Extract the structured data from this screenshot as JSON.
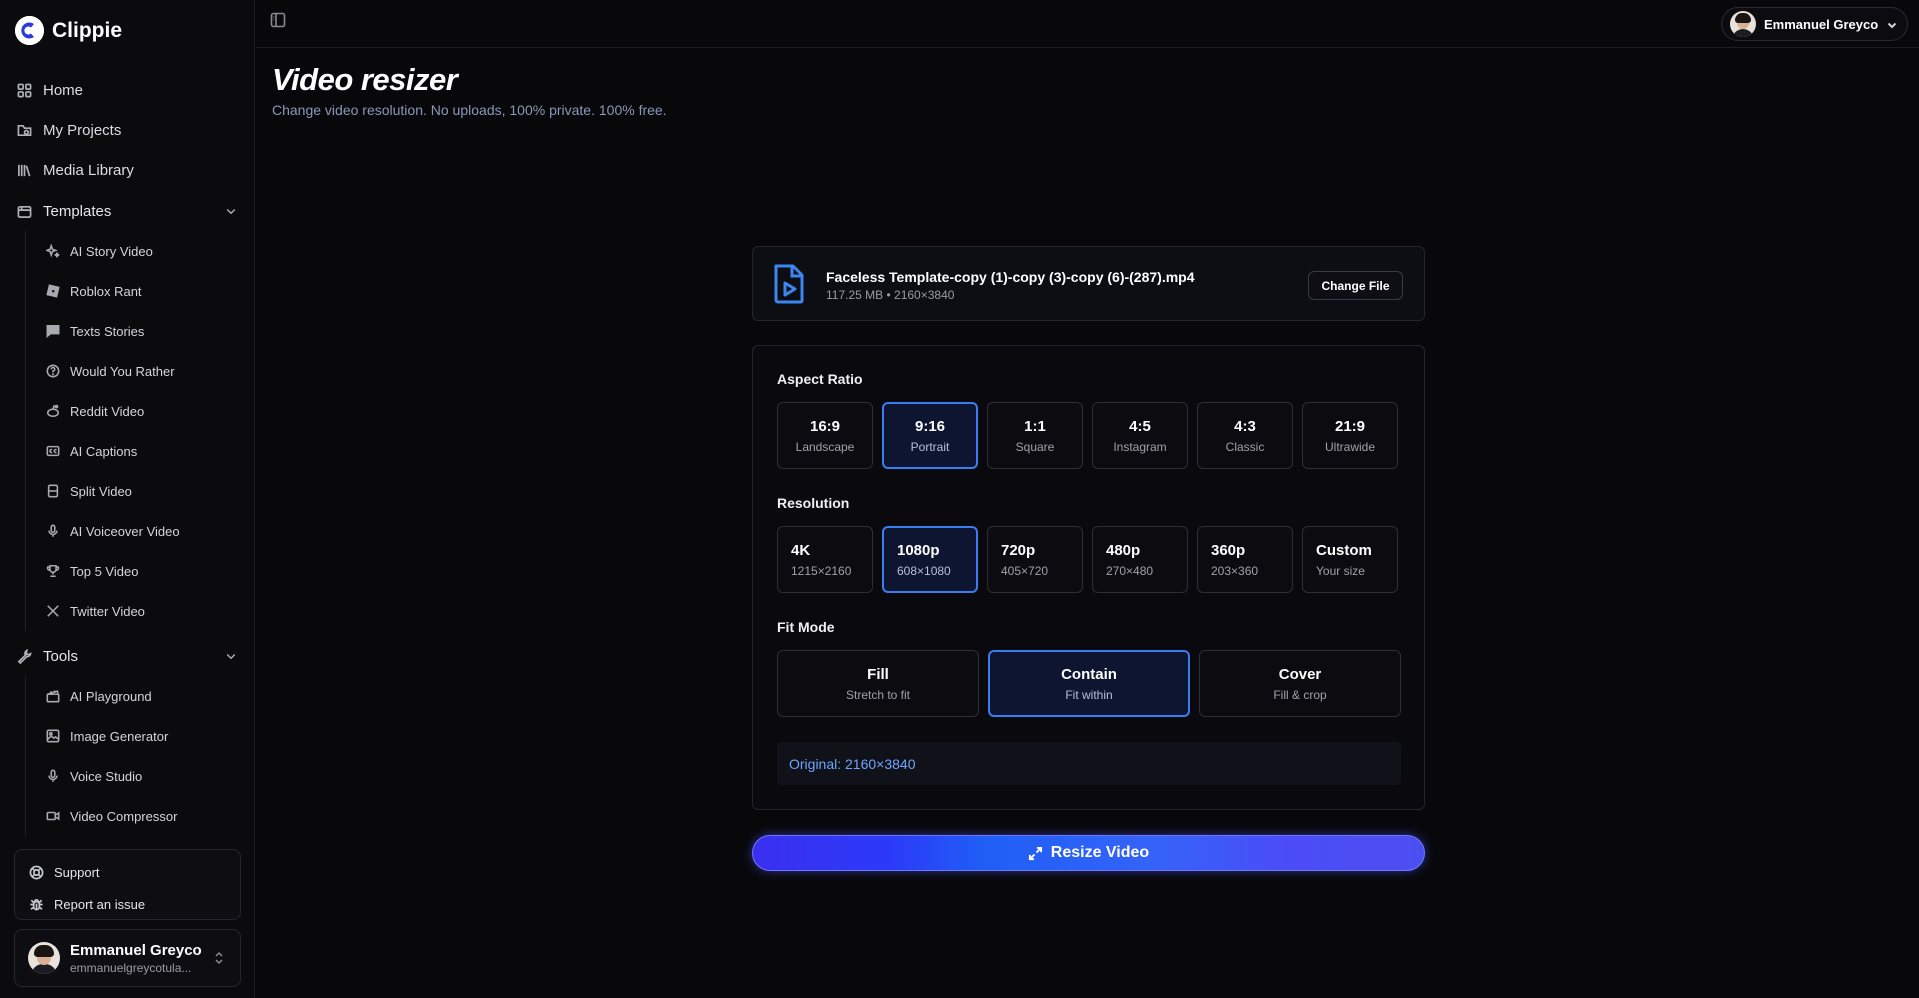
{
  "app": {
    "name": "Clippie"
  },
  "sidebar": {
    "nav": [
      {
        "label": "Home",
        "icon": "grid-icon"
      },
      {
        "label": "My Projects",
        "icon": "folder-icon"
      },
      {
        "label": "Media Library",
        "icon": "library-icon"
      }
    ],
    "templates": {
      "label": "Templates",
      "items": [
        {
          "label": "AI Story Video",
          "icon": "sparkle-icon"
        },
        {
          "label": "Roblox Rant",
          "icon": "roblox-icon"
        },
        {
          "label": "Texts Stories",
          "icon": "message-icon"
        },
        {
          "label": "Would You Rather",
          "icon": "question-icon"
        },
        {
          "label": "Reddit Video",
          "icon": "reddit-icon"
        },
        {
          "label": "AI Captions",
          "icon": "captions-icon"
        },
        {
          "label": "Split Video",
          "icon": "split-icon"
        },
        {
          "label": "AI Voiceover Video",
          "icon": "mic-icon"
        },
        {
          "label": "Top 5 Video",
          "icon": "trophy-icon"
        },
        {
          "label": "Twitter Video",
          "icon": "x-logo-icon"
        }
      ]
    },
    "tools": {
      "label": "Tools",
      "items": [
        {
          "label": "AI Playground",
          "icon": "clapper-icon"
        },
        {
          "label": "Image Generator",
          "icon": "image-icon"
        },
        {
          "label": "Voice Studio",
          "icon": "mic-icon"
        },
        {
          "label": "Video Compressor",
          "icon": "video-icon"
        }
      ]
    },
    "help": [
      {
        "label": "Support",
        "icon": "lifebuoy-icon"
      },
      {
        "label": "Report an issue",
        "icon": "bug-icon"
      }
    ],
    "user": {
      "name": "Emmanuel Greyco",
      "email": "emmanuelgreycotula..."
    }
  },
  "topbar": {
    "user_name": "Emmanuel Greyco"
  },
  "main": {
    "title": "Video resizer",
    "subtitle": "Change video resolution. No uploads, 100% private. 100% free.",
    "file": {
      "name": "Faceless Template-copy (1)-copy (3)-copy (6)-(287).mp4",
      "meta": "117.25 MB • 2160×3840",
      "change_label": "Change File"
    },
    "aspect": {
      "label": "Aspect Ratio",
      "options": [
        {
          "value": "16:9",
          "desc": "Landscape"
        },
        {
          "value": "9:16",
          "desc": "Portrait"
        },
        {
          "value": "1:1",
          "desc": "Square"
        },
        {
          "value": "4:5",
          "desc": "Instagram"
        },
        {
          "value": "4:3",
          "desc": "Classic"
        },
        {
          "value": "21:9",
          "desc": "Ultrawide"
        }
      ],
      "selected": 1
    },
    "resolution": {
      "label": "Resolution",
      "options": [
        {
          "value": "4K",
          "desc": "1215×2160"
        },
        {
          "value": "1080p",
          "desc": "608×1080"
        },
        {
          "value": "720p",
          "desc": "405×720"
        },
        {
          "value": "480p",
          "desc": "270×480"
        },
        {
          "value": "360p",
          "desc": "203×360"
        },
        {
          "value": "Custom",
          "desc": "Your size"
        }
      ],
      "selected": 1
    },
    "fit": {
      "label": "Fit Mode",
      "options": [
        {
          "value": "Fill",
          "desc": "Stretch to fit"
        },
        {
          "value": "Contain",
          "desc": "Fit within"
        },
        {
          "value": "Cover",
          "desc": "Fill & crop"
        }
      ],
      "selected": 1
    },
    "original": "Original: 2160×3840",
    "resize_label": "Resize Video"
  },
  "colors": {
    "accent": "#3b7cf0",
    "selected_bg": "#0d1530",
    "original_text": "#6ea4ff"
  }
}
